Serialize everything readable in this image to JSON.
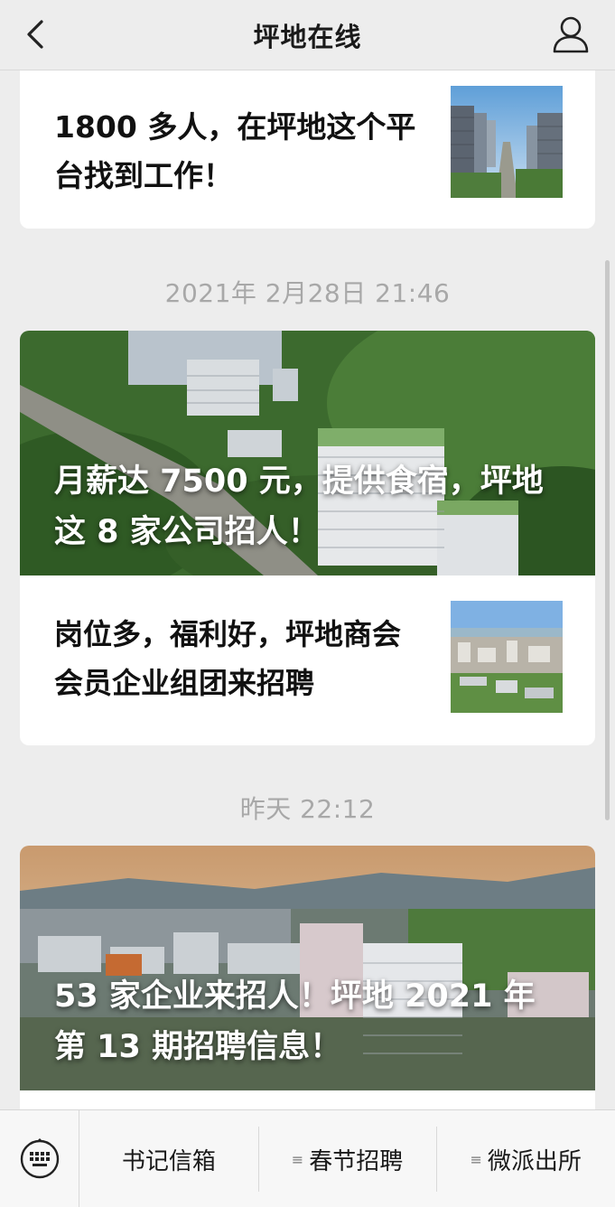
{
  "navbar": {
    "title": "坪地在线",
    "back_icon": "chevron-left-icon",
    "profile_icon": "person-icon"
  },
  "articles": [
    {
      "title": "1800 多人，在坪地这个平台找到工作！",
      "thumbnail": "city-street-photo"
    }
  ],
  "timestamps": [
    "2021年 2月28日 21:46",
    "昨天 22:12"
  ],
  "groups": [
    {
      "cover_title": "月薪达 7500 元，提供食宿，坪地这 8 家公司招人！",
      "sub_articles": [
        {
          "title": "岗位多，福利好，坪地商会会员企业组团来招聘",
          "thumbnail": "industrial-park-photo"
        }
      ]
    },
    {
      "cover_title": "53 家企业来招人！坪地 2021 年第 13 期招聘信息！"
    }
  ],
  "bottom_menu": {
    "keyboard_icon": "keyboard-icon",
    "items": [
      {
        "label": "书记信箱",
        "has_submenu": false
      },
      {
        "label": "春节招聘",
        "has_submenu": true
      },
      {
        "label": "微派出所",
        "has_submenu": true
      }
    ],
    "submenu_glyph": "≡"
  },
  "colors": {
    "background": "#ededed",
    "card": "#ffffff",
    "timestamp": "#a8a8a8",
    "title_text": "#111111"
  }
}
